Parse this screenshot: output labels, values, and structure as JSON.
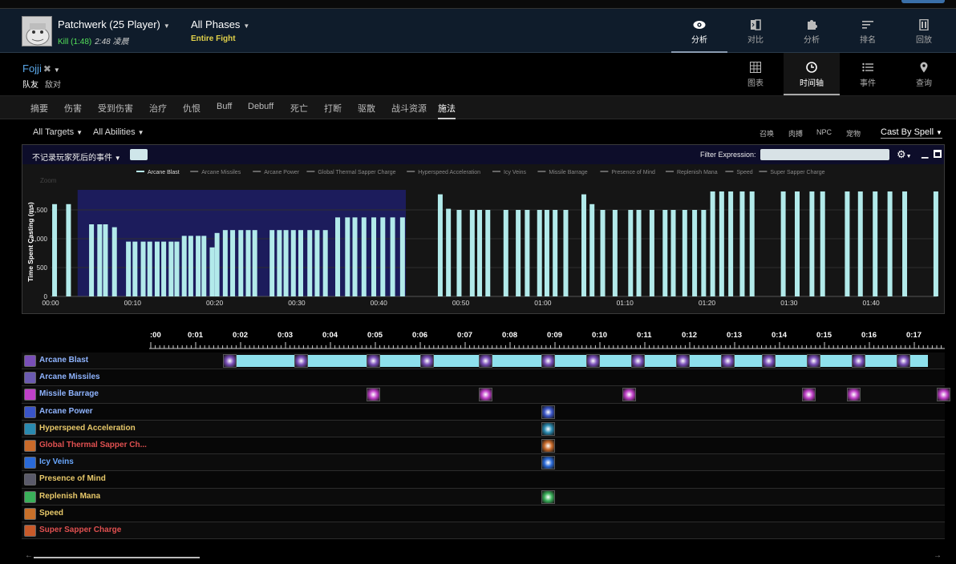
{
  "header": {
    "boss": "Patchwerk (25 Player)",
    "kill": "Kill (1:48)",
    "time": "2:48 凌晨",
    "phase": "All Phases",
    "phase_sub": "Entire Fight",
    "nav": [
      {
        "label": "分析",
        "icon": "eye-icon",
        "active": true
      },
      {
        "label": "对比",
        "icon": "compare-icon",
        "active": false
      },
      {
        "label": "分析",
        "icon": "puzzle-icon",
        "active": false
      },
      {
        "label": "排名",
        "icon": "rank-icon",
        "active": false
      },
      {
        "label": "回放",
        "icon": "replay-icon",
        "active": false
      }
    ]
  },
  "player": {
    "name": "Fojji",
    "tabs": [
      "队友",
      "敌对"
    ],
    "nav": [
      {
        "label": "图表",
        "icon": "grid-icon",
        "active": false
      },
      {
        "label": "时间轴",
        "icon": "clock-icon",
        "active": true
      },
      {
        "label": "事件",
        "icon": "list-icon",
        "active": false
      },
      {
        "label": "查询",
        "icon": "pin-icon",
        "active": false
      }
    ]
  },
  "tabs": [
    "摘要",
    "伤害",
    "受到伤害",
    "治疗",
    "仇恨",
    "Buff",
    "Debuff",
    "死亡",
    "打断",
    "驱散",
    "战斗资源",
    "施法"
  ],
  "active_tab": "施法",
  "filters": {
    "targets": "All Targets",
    "abilities": "All Abilities",
    "right": [
      "召唤",
      "肉搏",
      "NPC",
      "宠物"
    ],
    "castby": "Cast By Spell"
  },
  "chart_panel": {
    "dropdown": "不记录玩家死后的事件",
    "filter_label": "Filter Expression:",
    "zoom_label": "Zoom"
  },
  "chart_data": {
    "type": "bar",
    "ylabel": "Time Spent Casting (ms)",
    "yticks": [
      0,
      500,
      1000,
      1500
    ],
    "ylim": [
      0,
      2000
    ],
    "xlim": [
      0,
      108
    ],
    "xticks": [
      "00:00",
      "00:10",
      "00:20",
      "00:30",
      "00:40",
      "00:50",
      "01:00",
      "01:10",
      "01:20",
      "01:30",
      "01:40"
    ],
    "legend": [
      "Arcane Blast",
      "Arcane Missiles",
      "Arcane Power",
      "Global Thermal Sapper Charge",
      "Hyperspeed Acceleration",
      "Icy Veins",
      "Missile Barrage",
      "Presence of Mind",
      "Replenish Mana",
      "Speed",
      "Super Sapper Charge"
    ],
    "highlight_range": [
      3.3,
      43.3
    ],
    "series": [
      {
        "name": "Arcane Blast",
        "x": [
          0.2,
          1.9,
          4.7,
          5.7,
          6.4,
          7.5,
          9.2,
          10.0,
          11.0,
          11.8,
          12.7,
          13.5,
          14.4,
          15.1,
          16.0,
          16.8,
          17.7,
          18.4,
          19.4,
          20.0,
          21.0,
          21.9,
          22.9,
          23.8,
          24.6,
          26.7,
          27.6,
          28.4,
          29.3,
          30.2,
          31.3,
          32.2,
          33.2,
          34.7,
          35.9,
          36.8,
          37.9,
          39.1,
          40.2,
          41.4,
          42.6,
          47.2,
          48.2,
          49.5,
          51.1,
          52.0,
          53.0,
          55.2,
          56.7,
          57.8,
          59.3,
          60.2,
          61.2,
          62.5,
          64.7,
          65.7,
          67.0,
          68.5,
          70.4,
          71.4,
          73.0,
          74.6,
          75.6,
          77.0,
          78.2,
          79.3,
          80.4,
          81.5,
          82.6,
          84.0,
          85.2,
          89.0,
          90.7,
          92.5,
          93.8,
          96.8,
          98.4,
          100.2,
          102.0,
          103.8,
          107.6
        ],
        "values": [
          1600,
          1600,
          1250,
          1250,
          1250,
          1200,
          950,
          950,
          950,
          950,
          950,
          950,
          950,
          950,
          1050,
          1050,
          1050,
          1050,
          850,
          1100,
          1150,
          1150,
          1150,
          1150,
          1150,
          1150,
          1150,
          1150,
          1150,
          1150,
          1150,
          1150,
          1150,
          1370,
          1370,
          1370,
          1370,
          1370,
          1370,
          1370,
          1370,
          1770,
          1520,
          1500,
          1500,
          1500,
          1500,
          1500,
          1500,
          1500,
          1500,
          1500,
          1500,
          1500,
          1770,
          1600,
          1500,
          1500,
          1500,
          1500,
          1500,
          1500,
          1500,
          1500,
          1500,
          1500,
          1820,
          1820,
          1820,
          1820,
          1820,
          1820,
          1820,
          1820,
          1820,
          1820,
          1820,
          1820,
          1820,
          1820,
          1820
        ]
      }
    ]
  },
  "timeline": {
    "ticks": [
      ":00",
      "0:01",
      "0:02",
      "0:03",
      "0:04",
      "0:05",
      "0:06",
      "0:07",
      "0:08",
      "0:09",
      "0:10",
      "0:11",
      "0:12",
      "0:13",
      "0:14",
      "0:15",
      "0:16",
      "0:17"
    ],
    "rows": [
      {
        "name": "Arcane Blast",
        "color": "#8fb4ff",
        "icon_color": "#7a4fb8",
        "bars": [
          [
            1.6,
            17.3
          ]
        ],
        "casts": [
          1.6,
          3.2,
          4.8,
          6.0,
          7.3,
          8.7,
          9.7,
          10.7,
          11.7,
          12.7,
          13.6,
          14.6,
          15.6,
          16.6
        ]
      },
      {
        "name": "Arcane Missiles",
        "color": "#8fb4ff",
        "icon_color": "#6b5ab0",
        "bars": [],
        "casts": []
      },
      {
        "name": "Missile Barrage",
        "color": "#8fb4ff",
        "icon_color": "#c040c8",
        "bars": [],
        "casts": [
          4.8,
          7.3,
          10.5,
          14.5,
          15.5,
          17.5
        ]
      },
      {
        "name": "Arcane Power",
        "color": "#8fb4ff",
        "icon_color": "#3a55c8",
        "bars": [],
        "casts": [
          8.7
        ]
      },
      {
        "name": "Hyperspeed Acceleration",
        "color": "#e8c96a",
        "icon_color": "#2a8ab0",
        "bars": [],
        "casts": [
          8.7
        ]
      },
      {
        "name": "Global Thermal Sapper Ch...",
        "color": "#e05050",
        "icon_color": "#c86a2a",
        "bars": [],
        "casts": [
          8.7
        ]
      },
      {
        "name": "Icy Veins",
        "color": "#6aa8ff",
        "icon_color": "#2a6ad8",
        "bars": [],
        "casts": [
          8.7
        ]
      },
      {
        "name": "Presence of Mind",
        "color": "#e8c96a",
        "icon_color": "#5a5a6a",
        "bars": [],
        "casts": []
      },
      {
        "name": "Replenish Mana",
        "color": "#e8c96a",
        "icon_color": "#3ab05a",
        "bars": [],
        "casts": [
          8.7
        ]
      },
      {
        "name": "Speed",
        "color": "#e8c96a",
        "icon_color": "#c8702a",
        "bars": [],
        "casts": []
      },
      {
        "name": "Super Sapper Charge",
        "color": "#e05050",
        "icon_color": "#c85a2a",
        "bars": [],
        "casts": []
      }
    ]
  }
}
